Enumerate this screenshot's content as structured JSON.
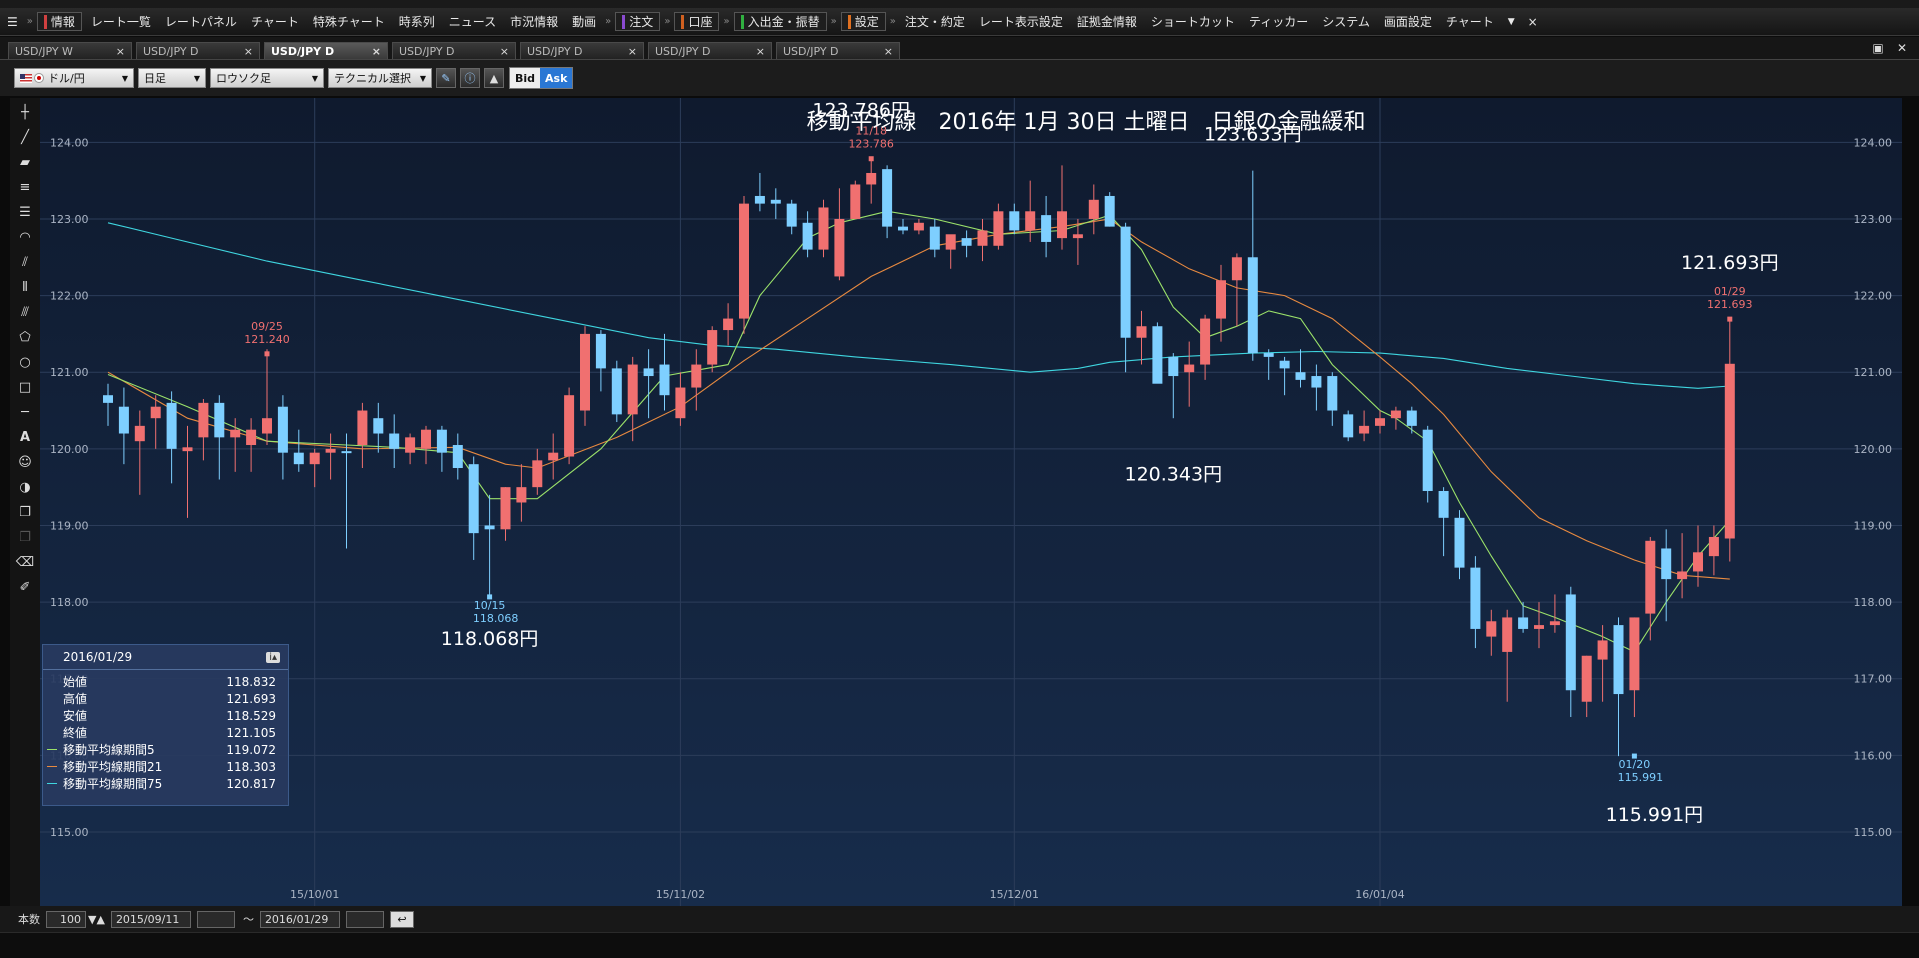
{
  "menubar": {
    "items": [
      {
        "label": "情報",
        "color": "#d04040",
        "boxed": true
      },
      {
        "label": "レート一覧"
      },
      {
        "label": "レートパネル"
      },
      {
        "label": "チャート"
      },
      {
        "label": "特殊チャート"
      },
      {
        "label": "時系列"
      },
      {
        "label": "ニュース"
      },
      {
        "label": "市況情報"
      },
      {
        "label": "動画"
      },
      {
        "label": "注文",
        "color": "#8a4ad0",
        "boxed": true
      },
      {
        "label": "口座",
        "color": "#d06020",
        "boxed": true
      },
      {
        "label": "入出金・振替",
        "color": "#30b040",
        "boxed": true
      },
      {
        "label": "設定",
        "color": "#e07020",
        "boxed": true
      },
      {
        "label": "注文・約定"
      },
      {
        "label": "レート表示設定"
      },
      {
        "label": "証拠金情報"
      },
      {
        "label": "ショートカット"
      },
      {
        "label": "ティッカー"
      },
      {
        "label": "システム"
      },
      {
        "label": "画面設定"
      },
      {
        "label": "チャート"
      }
    ],
    "close": "×"
  },
  "tabs": [
    {
      "label": "USD/JPY W",
      "active": false
    },
    {
      "label": "USD/JPY D",
      "active": false
    },
    {
      "label": "USD/JPY D",
      "active": true
    },
    {
      "label": "USD/JPY D",
      "active": false
    },
    {
      "label": "USD/JPY D",
      "active": false
    },
    {
      "label": "USD/JPY D",
      "active": false
    },
    {
      "label": "USD/JPY D",
      "active": false
    }
  ],
  "toolbar": {
    "pair": "ドル/円",
    "period": "日足",
    "chart_kind": "ロウソク足",
    "technical": "テクニカル選択",
    "bid": "Bid",
    "ask": "Ask"
  },
  "bottom": {
    "count_label": "本数",
    "count_value": "100",
    "from_date": "2015/09/11",
    "tilde": "～",
    "to_date": "2016/01/29"
  },
  "infobox": {
    "date": "2016/01/29",
    "rows": [
      {
        "label": "始値",
        "value": "118.832"
      },
      {
        "label": "高値",
        "value": "121.693"
      },
      {
        "label": "安値",
        "value": "118.529"
      },
      {
        "label": "終値",
        "value": "121.105"
      },
      {
        "label": "移動平均線期間5",
        "value": "119.072",
        "color": "#9be26a"
      },
      {
        "label": "移動平均線期間21",
        "value": "118.303",
        "color": "#e88a40"
      },
      {
        "label": "移動平均線期間75",
        "value": "120.817",
        "color": "#3fd6e0"
      }
    ]
  },
  "colors": {
    "up": "#f07070",
    "down": "#7ecfff",
    "ma5": "#9be26a",
    "ma21": "#e88a40",
    "ma75": "#3fd6e0",
    "grid": "#2c3d5a",
    "axis_text": "#aab4c4"
  },
  "chart_data": {
    "type": "candlestick",
    "title": "移動平均線　2016年 1月 30日 土曜日　日銀の金融緩和",
    "ylim": [
      115,
      124.2
    ],
    "yticks": [
      "115.00",
      "116.00",
      "117.00",
      "118.00",
      "119.00",
      "120.00",
      "121.00",
      "122.00",
      "123.00",
      "124.00"
    ],
    "xticks": [
      {
        "index": 13,
        "label": "15/10/01"
      },
      {
        "index": 36,
        "label": "15/11/02"
      },
      {
        "index": 57,
        "label": "15/12/01"
      },
      {
        "index": 80,
        "label": "16/01/04"
      }
    ],
    "candles": [
      {
        "o": 120.7,
        "h": 120.85,
        "l": 120.3,
        "c": 120.6
      },
      {
        "o": 120.55,
        "h": 120.8,
        "l": 119.8,
        "c": 120.2
      },
      {
        "o": 120.1,
        "h": 120.5,
        "l": 119.4,
        "c": 120.3
      },
      {
        "o": 120.4,
        "h": 120.7,
        "l": 120.0,
        "c": 120.55
      },
      {
        "o": 120.6,
        "h": 120.75,
        "l": 119.55,
        "c": 120.0
      },
      {
        "o": 119.97,
        "h": 120.3,
        "l": 119.1,
        "c": 120.02
      },
      {
        "o": 120.15,
        "h": 120.65,
        "l": 119.85,
        "c": 120.6
      },
      {
        "o": 120.6,
        "h": 120.7,
        "l": 119.6,
        "c": 120.15
      },
      {
        "o": 120.15,
        "h": 120.4,
        "l": 119.7,
        "c": 120.25
      },
      {
        "o": 120.05,
        "h": 120.4,
        "l": 119.7,
        "c": 120.25
      },
      {
        "o": 120.2,
        "h": 121.3,
        "l": 120.05,
        "c": 120.4
      },
      {
        "o": 120.55,
        "h": 120.7,
        "l": 119.6,
        "c": 119.95
      },
      {
        "o": 119.95,
        "h": 120.25,
        "l": 119.7,
        "c": 119.8
      },
      {
        "o": 119.8,
        "h": 120.0,
        "l": 119.5,
        "c": 119.95
      },
      {
        "o": 119.95,
        "h": 120.2,
        "l": 119.6,
        "c": 120.0
      },
      {
        "o": 119.97,
        "h": 120.2,
        "l": 118.7,
        "c": 119.95
      },
      {
        "o": 120.05,
        "h": 120.6,
        "l": 119.75,
        "c": 120.5
      },
      {
        "o": 120.4,
        "h": 120.6,
        "l": 119.95,
        "c": 120.2
      },
      {
        "o": 120.2,
        "h": 120.45,
        "l": 119.75,
        "c": 120.0
      },
      {
        "o": 119.95,
        "h": 120.2,
        "l": 119.8,
        "c": 120.15
      },
      {
        "o": 120.0,
        "h": 120.3,
        "l": 119.8,
        "c": 120.25
      },
      {
        "o": 120.25,
        "h": 120.3,
        "l": 119.7,
        "c": 119.95
      },
      {
        "o": 120.05,
        "h": 120.2,
        "l": 119.6,
        "c": 119.75
      },
      {
        "o": 119.8,
        "h": 119.9,
        "l": 118.55,
        "c": 118.9
      },
      {
        "o": 119.0,
        "h": 119.4,
        "l": 118.07,
        "c": 118.95
      },
      {
        "o": 118.95,
        "h": 119.5,
        "l": 118.8,
        "c": 119.5
      },
      {
        "o": 119.3,
        "h": 119.8,
        "l": 119.05,
        "c": 119.5
      },
      {
        "o": 119.5,
        "h": 120.0,
        "l": 119.4,
        "c": 119.85
      },
      {
        "o": 119.85,
        "h": 120.2,
        "l": 119.6,
        "c": 119.95
      },
      {
        "o": 119.9,
        "h": 120.8,
        "l": 119.8,
        "c": 120.7
      },
      {
        "o": 120.5,
        "h": 121.6,
        "l": 120.3,
        "c": 121.5
      },
      {
        "o": 121.5,
        "h": 121.55,
        "l": 120.75,
        "c": 121.05
      },
      {
        "o": 121.05,
        "h": 121.15,
        "l": 120.35,
        "c": 120.45
      },
      {
        "o": 120.45,
        "h": 121.2,
        "l": 120.1,
        "c": 121.1
      },
      {
        "o": 121.05,
        "h": 121.3,
        "l": 120.4,
        "c": 120.95
      },
      {
        "o": 121.1,
        "h": 121.5,
        "l": 120.5,
        "c": 120.7
      },
      {
        "o": 120.4,
        "h": 121.0,
        "l": 120.3,
        "c": 120.8
      },
      {
        "o": 120.8,
        "h": 121.3,
        "l": 120.5,
        "c": 121.1
      },
      {
        "o": 121.1,
        "h": 121.6,
        "l": 121.0,
        "c": 121.55
      },
      {
        "o": 121.55,
        "h": 121.9,
        "l": 121.35,
        "c": 121.7
      },
      {
        "o": 121.7,
        "h": 123.3,
        "l": 121.5,
        "c": 123.2
      },
      {
        "o": 123.3,
        "h": 123.6,
        "l": 123.1,
        "c": 123.2
      },
      {
        "o": 123.25,
        "h": 123.4,
        "l": 123.0,
        "c": 123.2
      },
      {
        "o": 123.2,
        "h": 123.25,
        "l": 122.8,
        "c": 122.9
      },
      {
        "o": 122.95,
        "h": 123.1,
        "l": 122.5,
        "c": 122.6
      },
      {
        "o": 122.6,
        "h": 123.25,
        "l": 122.5,
        "c": 123.15
      },
      {
        "o": 122.25,
        "h": 123.4,
        "l": 122.2,
        "c": 123.0
      },
      {
        "o": 123.0,
        "h": 123.5,
        "l": 123.0,
        "c": 123.45
      },
      {
        "o": 123.45,
        "h": 123.79,
        "l": 123.2,
        "c": 123.6
      },
      {
        "o": 123.65,
        "h": 123.7,
        "l": 122.75,
        "c": 122.9
      },
      {
        "o": 122.9,
        "h": 123.0,
        "l": 122.8,
        "c": 122.85
      },
      {
        "o": 122.85,
        "h": 123.0,
        "l": 122.8,
        "c": 122.95
      },
      {
        "o": 122.9,
        "h": 123.0,
        "l": 122.5,
        "c": 122.6
      },
      {
        "o": 122.6,
        "h": 122.75,
        "l": 122.35,
        "c": 122.8
      },
      {
        "o": 122.75,
        "h": 122.85,
        "l": 122.5,
        "c": 122.65
      },
      {
        "o": 122.65,
        "h": 123.0,
        "l": 122.45,
        "c": 122.85
      },
      {
        "o": 122.65,
        "h": 123.2,
        "l": 122.6,
        "c": 123.1
      },
      {
        "o": 123.1,
        "h": 123.2,
        "l": 122.8,
        "c": 122.85
      },
      {
        "o": 122.85,
        "h": 123.5,
        "l": 122.7,
        "c": 123.1
      },
      {
        "o": 123.05,
        "h": 123.3,
        "l": 122.5,
        "c": 122.7
      },
      {
        "o": 122.75,
        "h": 123.7,
        "l": 122.6,
        "c": 123.1
      },
      {
        "o": 122.75,
        "h": 123.0,
        "l": 122.4,
        "c": 122.8
      },
      {
        "o": 123.0,
        "h": 123.45,
        "l": 122.8,
        "c": 123.25
      },
      {
        "o": 123.3,
        "h": 123.35,
        "l": 122.9,
        "c": 122.9
      },
      {
        "o": 122.9,
        "h": 122.95,
        "l": 121.0,
        "c": 121.45
      },
      {
        "o": 121.45,
        "h": 121.8,
        "l": 121.1,
        "c": 121.6
      },
      {
        "o": 121.6,
        "h": 121.65,
        "l": 120.9,
        "c": 120.85
      },
      {
        "o": 121.2,
        "h": 121.25,
        "l": 120.4,
        "c": 120.95
      },
      {
        "o": 121.0,
        "h": 121.4,
        "l": 120.55,
        "c": 121.1
      },
      {
        "o": 121.1,
        "h": 121.75,
        "l": 120.9,
        "c": 121.7
      },
      {
        "o": 121.7,
        "h": 122.4,
        "l": 121.4,
        "c": 122.2
      },
      {
        "o": 122.2,
        "h": 122.55,
        "l": 121.6,
        "c": 122.5
      },
      {
        "o": 122.5,
        "h": 123.63,
        "l": 121.15,
        "c": 121.25
      },
      {
        "o": 121.25,
        "h": 121.3,
        "l": 120.9,
        "c": 121.2
      },
      {
        "o": 121.15,
        "h": 121.2,
        "l": 120.7,
        "c": 121.05
      },
      {
        "o": 121.0,
        "h": 121.3,
        "l": 120.8,
        "c": 120.9
      },
      {
        "o": 120.95,
        "h": 121.1,
        "l": 120.5,
        "c": 120.8
      },
      {
        "o": 120.95,
        "h": 121.0,
        "l": 120.3,
        "c": 120.5
      },
      {
        "o": 120.45,
        "h": 120.5,
        "l": 120.1,
        "c": 120.15
      },
      {
        "o": 120.2,
        "h": 120.5,
        "l": 120.1,
        "c": 120.3
      },
      {
        "o": 120.3,
        "h": 120.5,
        "l": 120.2,
        "c": 120.4
      },
      {
        "o": 120.4,
        "h": 120.55,
        "l": 120.25,
        "c": 120.5
      },
      {
        "o": 120.5,
        "h": 120.55,
        "l": 120.2,
        "c": 120.3
      },
      {
        "o": 120.25,
        "h": 120.3,
        "l": 119.3,
        "c": 119.45
      },
      {
        "o": 119.45,
        "h": 119.5,
        "l": 118.6,
        "c": 119.1
      },
      {
        "o": 119.1,
        "h": 119.2,
        "l": 118.3,
        "c": 118.45
      },
      {
        "o": 118.45,
        "h": 118.6,
        "l": 117.4,
        "c": 117.65
      },
      {
        "o": 117.55,
        "h": 117.9,
        "l": 117.3,
        "c": 117.75
      },
      {
        "o": 117.35,
        "h": 117.9,
        "l": 116.7,
        "c": 117.8
      },
      {
        "o": 117.8,
        "h": 118.0,
        "l": 117.6,
        "c": 117.65
      },
      {
        "o": 117.65,
        "h": 118.0,
        "l": 117.4,
        "c": 117.7
      },
      {
        "o": 117.7,
        "h": 118.1,
        "l": 117.6,
        "c": 117.75
      },
      {
        "o": 118.1,
        "h": 118.2,
        "l": 116.5,
        "c": 116.85
      },
      {
        "o": 116.7,
        "h": 117.3,
        "l": 116.5,
        "c": 117.3
      },
      {
        "o": 117.25,
        "h": 117.7,
        "l": 116.7,
        "c": 117.5
      },
      {
        "o": 117.7,
        "h": 117.8,
        "l": 115.99,
        "c": 116.8
      },
      {
        "o": 116.85,
        "h": 117.8,
        "l": 116.5,
        "c": 117.8
      },
      {
        "o": 117.85,
        "h": 118.85,
        "l": 117.5,
        "c": 118.8
      },
      {
        "o": 118.7,
        "h": 118.95,
        "l": 117.75,
        "c": 118.3
      },
      {
        "o": 118.3,
        "h": 118.9,
        "l": 118.05,
        "c": 118.4
      },
      {
        "o": 118.4,
        "h": 119.0,
        "l": 118.2,
        "c": 118.65
      },
      {
        "o": 118.6,
        "h": 119.0,
        "l": 118.35,
        "c": 118.85
      },
      {
        "o": 118.83,
        "h": 121.69,
        "l": 118.53,
        "c": 121.11
      }
    ],
    "ma5": [
      [
        0,
        120.97
      ],
      [
        5,
        120.55
      ],
      [
        10,
        120.1
      ],
      [
        15,
        120.05
      ],
      [
        18,
        120.02
      ],
      [
        22,
        119.95
      ],
      [
        24,
        119.35
      ],
      [
        27,
        119.35
      ],
      [
        31,
        120.0
      ],
      [
        35,
        120.95
      ],
      [
        39,
        121.1
      ],
      [
        41,
        122.0
      ],
      [
        44,
        122.75
      ],
      [
        46,
        122.95
      ],
      [
        49,
        123.1
      ],
      [
        52,
        123.0
      ],
      [
        56,
        122.8
      ],
      [
        60,
        122.85
      ],
      [
        63,
        123.05
      ],
      [
        65,
        122.6
      ],
      [
        67,
        121.85
      ],
      [
        69,
        121.45
      ],
      [
        71,
        121.6
      ],
      [
        73,
        121.8
      ],
      [
        75,
        121.7
      ],
      [
        77,
        121.1
      ],
      [
        80,
        120.5
      ],
      [
        81,
        120.4
      ],
      [
        83,
        120.1
      ],
      [
        85,
        119.3
      ],
      [
        87,
        118.6
      ],
      [
        89,
        117.95
      ],
      [
        91,
        117.8
      ],
      [
        94,
        117.55
      ],
      [
        96,
        117.35
      ],
      [
        98,
        118.0
      ],
      [
        100,
        118.6
      ],
      [
        102,
        119.07
      ]
    ],
    "ma21": [
      [
        0,
        121.0
      ],
      [
        5,
        120.4
      ],
      [
        10,
        120.1
      ],
      [
        16,
        120.0
      ],
      [
        22,
        120.02
      ],
      [
        25,
        119.8
      ],
      [
        27,
        119.75
      ],
      [
        32,
        120.15
      ],
      [
        36,
        120.55
      ],
      [
        40,
        121.15
      ],
      [
        44,
        121.7
      ],
      [
        48,
        122.25
      ],
      [
        52,
        122.65
      ],
      [
        56,
        122.8
      ],
      [
        60,
        122.9
      ],
      [
        63,
        123.0
      ],
      [
        65,
        122.7
      ],
      [
        68,
        122.35
      ],
      [
        71,
        122.1
      ],
      [
        74,
        122.0
      ],
      [
        77,
        121.7
      ],
      [
        80,
        121.2
      ],
      [
        82,
        120.85
      ],
      [
        84,
        120.45
      ],
      [
        87,
        119.7
      ],
      [
        90,
        119.1
      ],
      [
        93,
        118.8
      ],
      [
        96,
        118.55
      ],
      [
        99,
        118.35
      ],
      [
        102,
        118.3
      ]
    ],
    "ma75": [
      [
        0,
        122.95
      ],
      [
        4,
        122.75
      ],
      [
        10,
        122.45
      ],
      [
        16,
        122.2
      ],
      [
        22,
        121.95
      ],
      [
        28,
        121.7
      ],
      [
        34,
        121.45
      ],
      [
        38,
        121.35
      ],
      [
        42,
        121.3
      ],
      [
        47,
        121.2
      ],
      [
        53,
        121.1
      ],
      [
        58,
        121.0
      ],
      [
        61,
        121.05
      ],
      [
        63,
        121.13
      ],
      [
        67,
        121.2
      ],
      [
        72,
        121.25
      ],
      [
        76,
        121.27
      ],
      [
        80,
        121.25
      ],
      [
        84,
        121.18
      ],
      [
        88,
        121.05
      ],
      [
        92,
        120.95
      ],
      [
        96,
        120.85
      ],
      [
        100,
        120.79
      ],
      [
        102,
        120.82
      ]
    ],
    "annotations": [
      {
        "label": "09/25",
        "value": "121.240",
        "idx": 10,
        "y": 121.24,
        "kind": "high"
      },
      {
        "label": "10/15",
        "value": "118.068",
        "idx": 24,
        "y": 118.068,
        "kind": "low"
      },
      {
        "label": "11/18",
        "value": "123.786",
        "idx": 48,
        "y": 123.786,
        "kind": "high"
      },
      {
        "label": "01/20",
        "value": "115.991",
        "idx": 96,
        "y": 115.991,
        "kind": "low"
      },
      {
        "label": "01/29",
        "value": "121.693",
        "idx": 102,
        "y": 121.693,
        "kind": "high"
      }
    ],
    "callouts": [
      {
        "text": "123.786円",
        "idx": 48,
        "y": 123.786
      },
      {
        "text": "123.633円",
        "idx": 72,
        "y": 123.633
      },
      {
        "text": "118.068円",
        "idx": 24,
        "y": 118.068
      },
      {
        "text": "120.343円",
        "idx": 67,
        "y": 120.343
      },
      {
        "text": "121.693円",
        "idx": 102,
        "y": 121.693
      },
      {
        "text": "115.991円",
        "idx": 96,
        "y": 115.991
      }
    ]
  }
}
